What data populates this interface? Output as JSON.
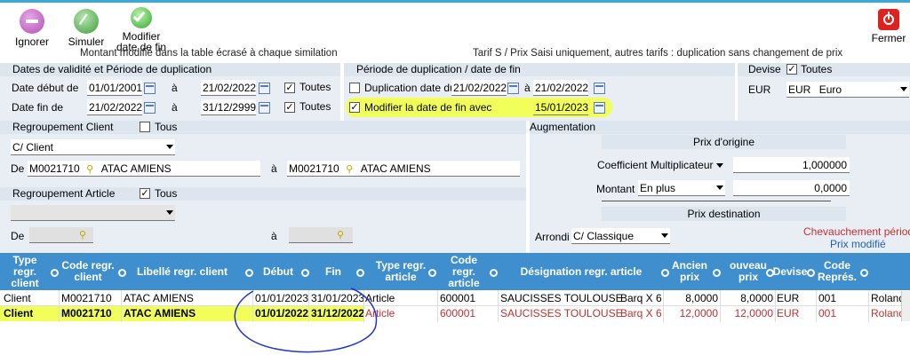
{
  "toolbar": {
    "ignore_label": "Ignorer",
    "simulate_label": "Simuler",
    "modify_label_1": "Modifier",
    "modify_label_2": "date de fin",
    "close_label": "Fermer"
  },
  "info": {
    "left": "Montant modifié dans la table écrasé à chaque similation",
    "right": "Tarif  S / Prix Saisi   uniquement, autres tarifs : duplication sans changement de prix"
  },
  "validity": {
    "title": "Dates de validité et Période de duplication",
    "start_label": "Date début de",
    "start_from": "01/01/2001",
    "to_label": "à",
    "start_to": "21/02/2022",
    "all_label": "Toutes",
    "end_label": "Date fin de",
    "end_from": "21/02/2022",
    "end_to": "31/12/2999"
  },
  "duplication": {
    "title": "Période de duplication / date de fin",
    "dup_label": "Duplication date du",
    "dup_from": "21/02/2022",
    "to_label": "à",
    "dup_to": "21/02/2022",
    "modify_label": "Modifier la date de fin avec",
    "modify_value": "15/01/2023"
  },
  "currency": {
    "title": "Devise",
    "all_label": "Toutes",
    "code": "EUR",
    "select_code": "EUR",
    "select_name": "Euro"
  },
  "client_group": {
    "title": "Regroupement Client",
    "all_label": "Tous",
    "type_value": "C/ Client",
    "from_label": "De",
    "from_code": "M0021710",
    "from_name": "ATAC  AMIENS",
    "to_label": "à",
    "to_code": "M0021710",
    "to_name": "ATAC  AMIENS"
  },
  "article_group": {
    "title": "Regroupement Article",
    "all_label": "Tous",
    "from_label": "De",
    "to_label": "à"
  },
  "augmentation": {
    "title": "Augmentation",
    "origin_title": "Prix d'origine",
    "coef_label": "Coefficient Multiplicateur",
    "coef_value": "1,000000",
    "amount_label": "Montant",
    "amount_mode": "En plus",
    "amount_value": "0,0000",
    "dest_title": "Prix destination",
    "round_label": "Arrondi",
    "round_value": "C/ Classique",
    "overlap_label": "Chevauchement période",
    "modified_label": "Prix modifié"
  },
  "grid": {
    "headers": [
      "Type regr. client",
      "Code regr. client",
      "Libellé regr. client",
      "Début",
      "Fin",
      "Type regr. article",
      "Code regr. article",
      "Désignation regr. article",
      "Ancien prix",
      "ouveau prix",
      "Devise",
      "Code Représ."
    ],
    "rows": [
      [
        "Client",
        "M0021710",
        "ATAC  AMIENS",
        "01/01/2023",
        "31/01/2023",
        "Article",
        "600001",
        "SAUCISSES TOULOUSE",
        "Barq X 6",
        "8,0000",
        "8,0000",
        "EUR",
        "001",
        "Roland"
      ],
      [
        "Client",
        "M0021710",
        "ATAC  AMIENS",
        "01/01/2022",
        "31/12/2022",
        "Article",
        "600001",
        "SAUCISSES TOULOUSE",
        "Barq X 6",
        "12,0000",
        "12,0000",
        "EUR",
        "001",
        "Roland"
      ]
    ]
  },
  "colors": {
    "grid_header": "#3f8fcf",
    "highlight": "#f2ff5a",
    "modified_text": "#c03030",
    "annotation": "#2233cc"
  }
}
